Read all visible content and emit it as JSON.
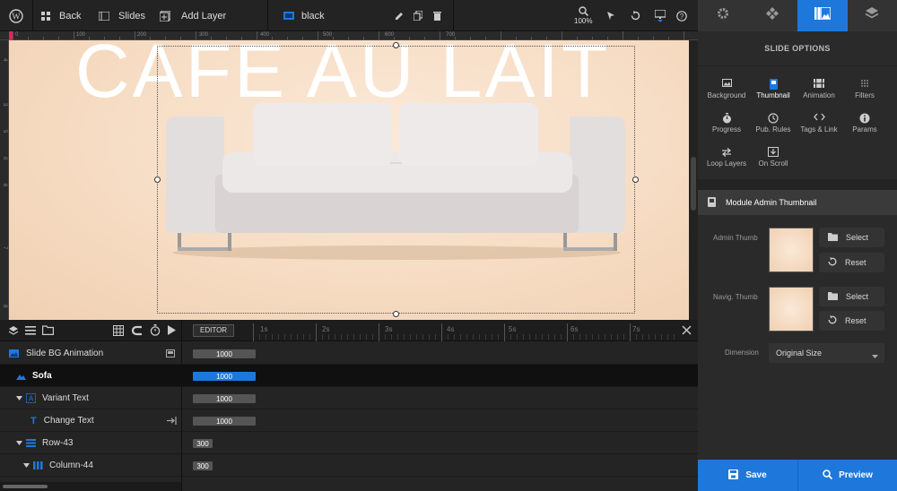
{
  "toolbar": {
    "back_label": "Back",
    "slides_label": "Slides",
    "add_layer_label": "Add Layer",
    "slide_name": "black",
    "zoom_label": "100%"
  },
  "ruler": {
    "h_labels": [
      "0",
      "100",
      "200",
      "300",
      "400",
      "500",
      "600",
      "700"
    ],
    "v_labels": [
      "4",
      "3",
      "5",
      "0",
      "6",
      "7",
      "8"
    ]
  },
  "canvas": {
    "headline": "CAFE AU LAIT"
  },
  "timeline": {
    "editor_label": "EDITOR",
    "time_marks": [
      "1s",
      "2s",
      "3s",
      "4s",
      "5s",
      "6s",
      "7s"
    ],
    "rows": [
      {
        "label": "Slide BG Animation",
        "bar": "1000"
      },
      {
        "label": "Sofa",
        "bar": "1000"
      },
      {
        "label": "Variant Text",
        "bar": "1000"
      },
      {
        "label": "Change Text",
        "bar": "1000"
      },
      {
        "label": "Row-43",
        "bar": "300"
      },
      {
        "label": "Column-44",
        "bar": "300"
      }
    ]
  },
  "panel": {
    "title": "SLIDE OPTIONS",
    "options": [
      {
        "label": "Background",
        "icon": "image-icon"
      },
      {
        "label": "Thumbnail",
        "icon": "thumbnail-icon"
      },
      {
        "label": "Animation",
        "icon": "film-icon"
      },
      {
        "label": "Filters",
        "icon": "filters-icon"
      },
      {
        "label": "Progress",
        "icon": "stopwatch-icon"
      },
      {
        "label": "Pub. Rules",
        "icon": "clock-icon"
      },
      {
        "label": "Tags & Link",
        "icon": "code-icon"
      },
      {
        "label": "Params",
        "icon": "info-icon"
      },
      {
        "label": "Loop Layers",
        "icon": "loop-icon"
      },
      {
        "label": "On Scroll",
        "icon": "download-icon"
      }
    ],
    "section_title": "Module Admin Thumbnail",
    "admin_thumb_label": "Admin Thumb",
    "navig_thumb_label": "Navig. Thumb",
    "select_label": "Select",
    "reset_label": "Reset",
    "dimension_label": "Dimension",
    "dimension_value": "Original Size",
    "save_label": "Save",
    "preview_label": "Preview"
  },
  "colors": {
    "accent": "#1e78dc",
    "canvas_bg": "#f6dcc3"
  }
}
